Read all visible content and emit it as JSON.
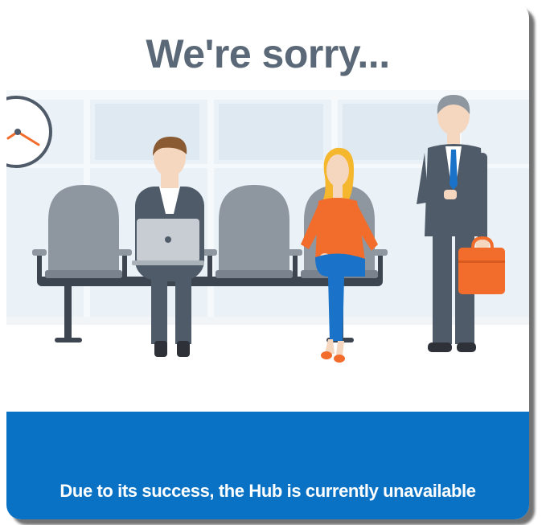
{
  "page": {
    "title": "We're sorry...",
    "message": "Due to its success, the Hub is currently unavailable"
  },
  "colors": {
    "title": "#5a6877",
    "banner": "#0a72c4",
    "banner_text": "#ffffff",
    "seat": "#8e969f",
    "window": "#e4edf4",
    "jacket": "#4f5b69",
    "orange": "#f26d2c"
  },
  "illustration": {
    "icons": [
      "wall-clock-icon",
      "waiting-seats",
      "man-with-laptop",
      "woman-seated",
      "businessman-with-briefcase"
    ]
  }
}
